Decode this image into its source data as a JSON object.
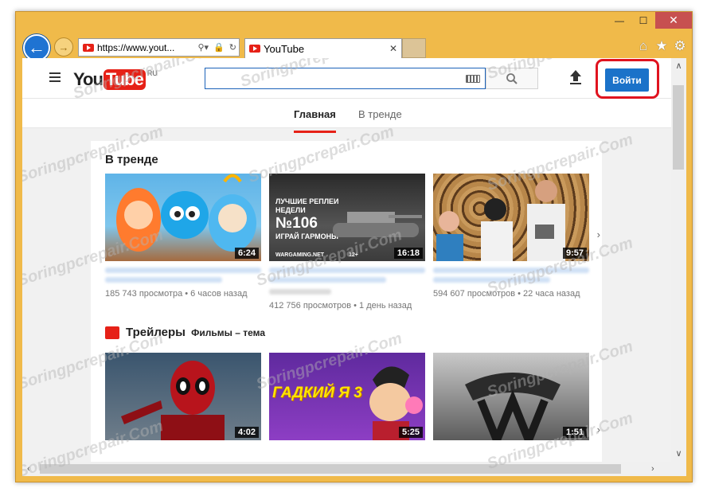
{
  "browser": {
    "address_url": "https://www.yout...",
    "tab_title": "YouTube",
    "window_buttons": {
      "minimize": "—",
      "maximize": "☐",
      "close": "✕"
    }
  },
  "youtube": {
    "logo_you": "You",
    "logo_tube": "Tube",
    "logo_region": "RU",
    "search_value": "",
    "signin_label": "Войти",
    "tabs": [
      {
        "label": "Главная"
      },
      {
        "label": "В тренде"
      }
    ],
    "trending": {
      "title": "В тренде",
      "videos": [
        {
          "duration": "6:24",
          "meta": "185 743 просмотра • 6 часов назад"
        },
        {
          "duration": "16:18",
          "meta": "412 756 просмотров • 1 день назад",
          "thumb_text": [
            "ЛУЧШИЕ РЕПЛЕИ",
            "НЕДЕЛИ",
            "№106",
            "ИГРАЙ ГАРМОНЫ",
            "WARGAMING.NET",
            "12+"
          ]
        },
        {
          "duration": "9:57",
          "meta": "594 607 просмотров • 22 часа назад"
        }
      ]
    },
    "trailers": {
      "title": "Трейлеры",
      "subtitle": "Фильмы – тема",
      "videos": [
        {
          "duration": "4:02"
        },
        {
          "duration": "5:25",
          "thumb_text": "ГАДКИЙ Я 3"
        },
        {
          "duration": "1:51"
        }
      ]
    }
  },
  "watermark": "Soringpcrepair.Com",
  "colors": {
    "accent": "#1b72c9",
    "youtube_red": "#e62117",
    "highlight": "#e0131f"
  }
}
